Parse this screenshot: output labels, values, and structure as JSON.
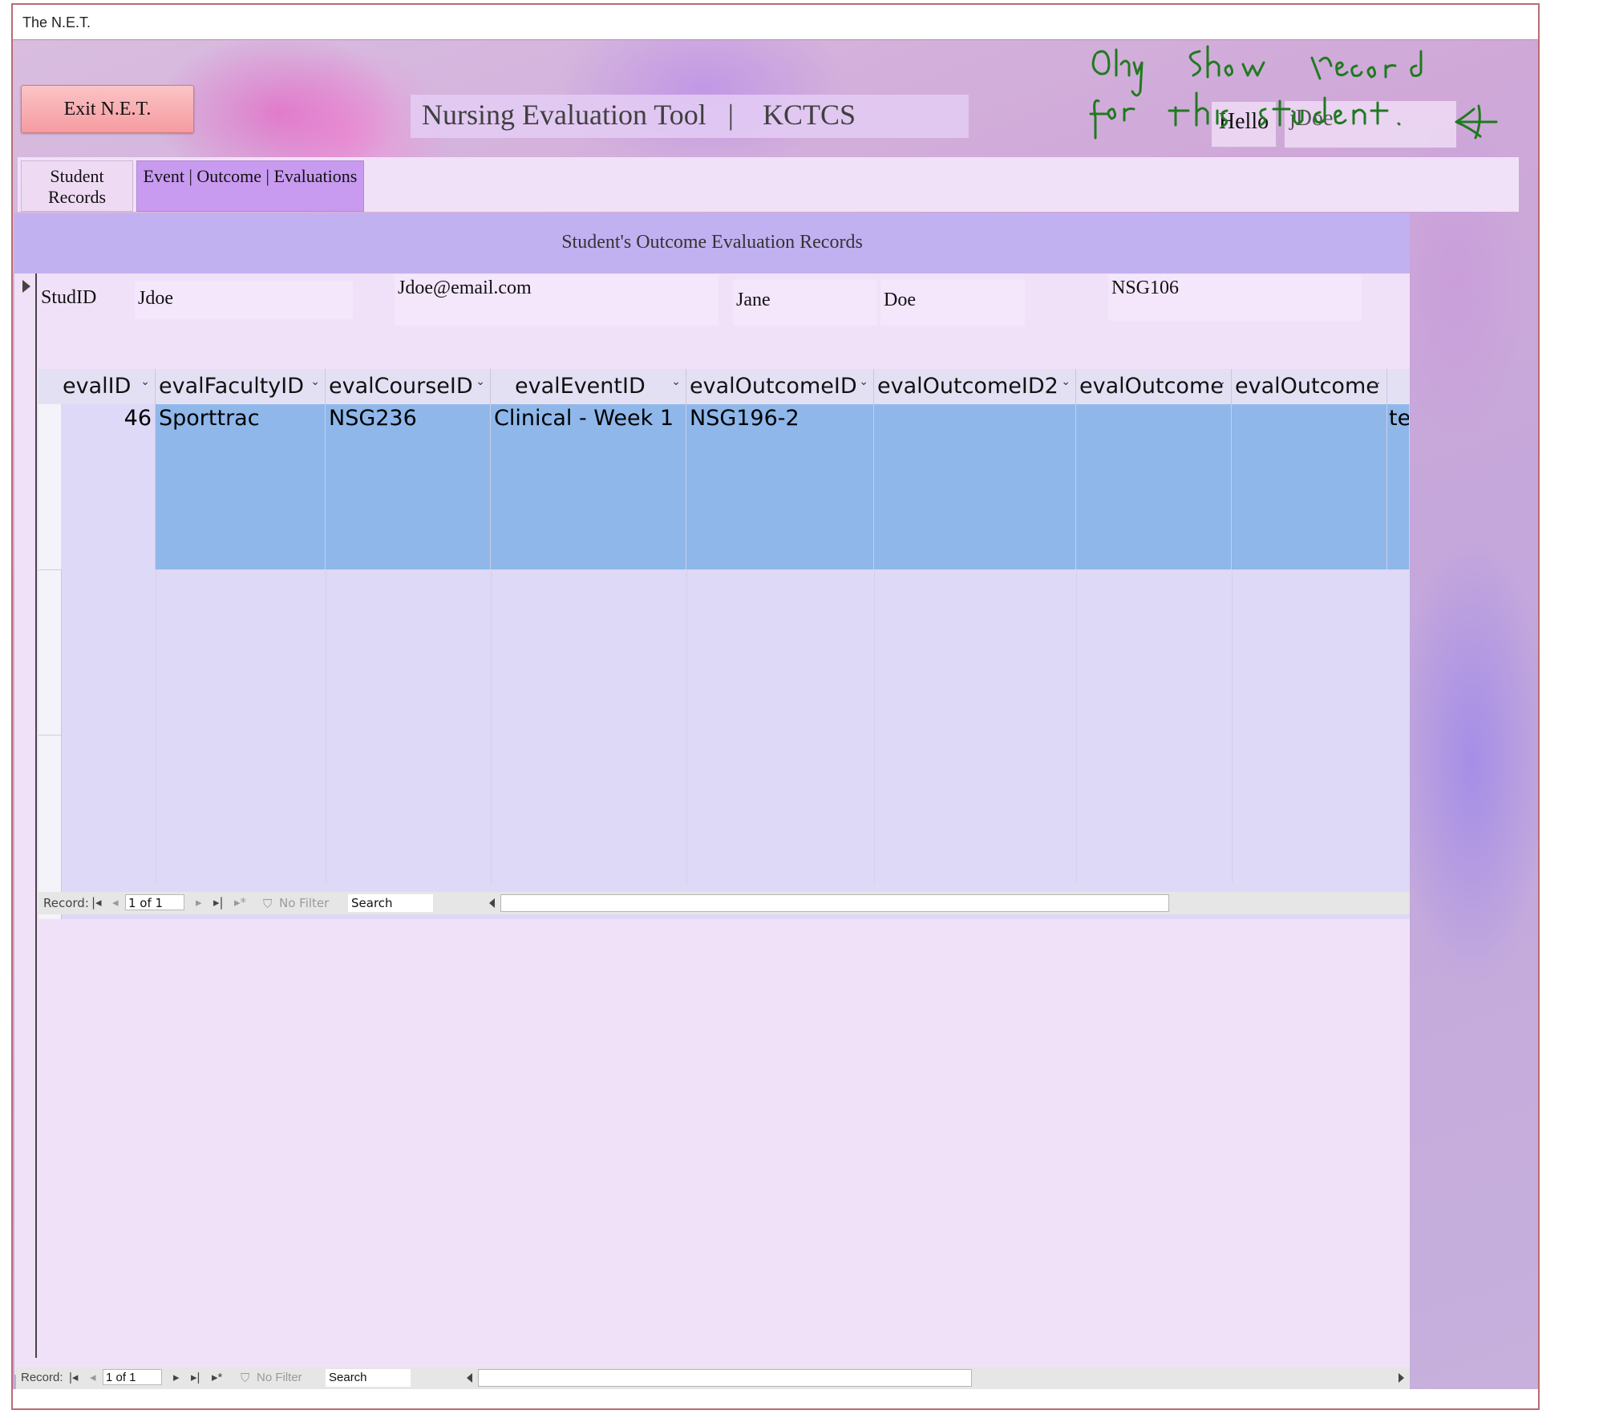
{
  "window": {
    "title": "The N.E.T."
  },
  "header": {
    "exit_label": "Exit N.E.T.",
    "app_title": "Nursing Evaluation Tool   |    KCTCS",
    "hello_label": "Hello",
    "username": "jDoe"
  },
  "tabs": [
    {
      "label": "Student Records"
    },
    {
      "label": "Event | Outcome | Evaluations",
      "selected": true
    }
  ],
  "form": {
    "title": "Student's Outcome Evaluation Records",
    "studid_label": "StudID",
    "studid_value": "Jdoe",
    "email": "Jdoe@email.com",
    "first_name": "Jane",
    "last_name": "Doe",
    "course": "NSG106"
  },
  "datasheet": {
    "columns": [
      "evalID",
      "evalFacultyID",
      "evalCourseID",
      "evalEventID",
      "evalOutcomeID",
      "evalOutcomeID2",
      "evalOutcome",
      "evalOutcome"
    ],
    "rows": [
      {
        "evalID": "46",
        "evalFacultyID": "Sporttrac",
        "evalCourseID": "NSG236",
        "evalEventID": "Clinical - Week 1",
        "evalOutcomeID": "NSG196-2",
        "evalOutcomeID2": "",
        "evalOutcome": "",
        "evalOutcome_2": "",
        "overflow": "te"
      }
    ]
  },
  "subform_nav": {
    "record_label": "Record:",
    "record_value": "1 of 1",
    "filter_label": "No Filter",
    "search_label": "Search"
  },
  "main_nav": {
    "record_label": "Record:",
    "record_value": "1 of 1",
    "filter_label": "No Filter",
    "search_label": "Search"
  },
  "annotation": {
    "text": "Only show record for this student.",
    "color": "#1f7a1f"
  },
  "colors": {
    "header_band": "#c2b1f1",
    "selected_row": "#8fb7ea",
    "active_tab": "#c89af0",
    "exit_button": "#f59ba0"
  }
}
